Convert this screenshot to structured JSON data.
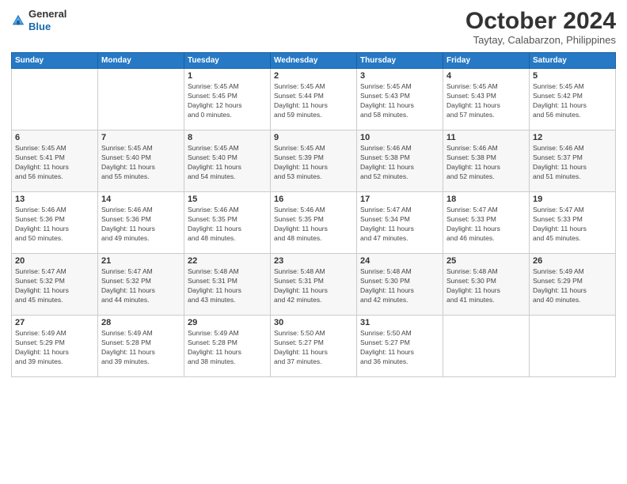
{
  "header": {
    "logo_general": "General",
    "logo_blue": "Blue",
    "month": "October 2024",
    "location": "Taytay, Calabarzon, Philippines"
  },
  "weekdays": [
    "Sunday",
    "Monday",
    "Tuesday",
    "Wednesday",
    "Thursday",
    "Friday",
    "Saturday"
  ],
  "weeks": [
    [
      {
        "day": "",
        "info": ""
      },
      {
        "day": "",
        "info": ""
      },
      {
        "day": "1",
        "info": "Sunrise: 5:45 AM\nSunset: 5:45 PM\nDaylight: 12 hours\nand 0 minutes."
      },
      {
        "day": "2",
        "info": "Sunrise: 5:45 AM\nSunset: 5:44 PM\nDaylight: 11 hours\nand 59 minutes."
      },
      {
        "day": "3",
        "info": "Sunrise: 5:45 AM\nSunset: 5:43 PM\nDaylight: 11 hours\nand 58 minutes."
      },
      {
        "day": "4",
        "info": "Sunrise: 5:45 AM\nSunset: 5:43 PM\nDaylight: 11 hours\nand 57 minutes."
      },
      {
        "day": "5",
        "info": "Sunrise: 5:45 AM\nSunset: 5:42 PM\nDaylight: 11 hours\nand 56 minutes."
      }
    ],
    [
      {
        "day": "6",
        "info": "Sunrise: 5:45 AM\nSunset: 5:41 PM\nDaylight: 11 hours\nand 56 minutes."
      },
      {
        "day": "7",
        "info": "Sunrise: 5:45 AM\nSunset: 5:40 PM\nDaylight: 11 hours\nand 55 minutes."
      },
      {
        "day": "8",
        "info": "Sunrise: 5:45 AM\nSunset: 5:40 PM\nDaylight: 11 hours\nand 54 minutes."
      },
      {
        "day": "9",
        "info": "Sunrise: 5:45 AM\nSunset: 5:39 PM\nDaylight: 11 hours\nand 53 minutes."
      },
      {
        "day": "10",
        "info": "Sunrise: 5:46 AM\nSunset: 5:38 PM\nDaylight: 11 hours\nand 52 minutes."
      },
      {
        "day": "11",
        "info": "Sunrise: 5:46 AM\nSunset: 5:38 PM\nDaylight: 11 hours\nand 52 minutes."
      },
      {
        "day": "12",
        "info": "Sunrise: 5:46 AM\nSunset: 5:37 PM\nDaylight: 11 hours\nand 51 minutes."
      }
    ],
    [
      {
        "day": "13",
        "info": "Sunrise: 5:46 AM\nSunset: 5:36 PM\nDaylight: 11 hours\nand 50 minutes."
      },
      {
        "day": "14",
        "info": "Sunrise: 5:46 AM\nSunset: 5:36 PM\nDaylight: 11 hours\nand 49 minutes."
      },
      {
        "day": "15",
        "info": "Sunrise: 5:46 AM\nSunset: 5:35 PM\nDaylight: 11 hours\nand 48 minutes."
      },
      {
        "day": "16",
        "info": "Sunrise: 5:46 AM\nSunset: 5:35 PM\nDaylight: 11 hours\nand 48 minutes."
      },
      {
        "day": "17",
        "info": "Sunrise: 5:47 AM\nSunset: 5:34 PM\nDaylight: 11 hours\nand 47 minutes."
      },
      {
        "day": "18",
        "info": "Sunrise: 5:47 AM\nSunset: 5:33 PM\nDaylight: 11 hours\nand 46 minutes."
      },
      {
        "day": "19",
        "info": "Sunrise: 5:47 AM\nSunset: 5:33 PM\nDaylight: 11 hours\nand 45 minutes."
      }
    ],
    [
      {
        "day": "20",
        "info": "Sunrise: 5:47 AM\nSunset: 5:32 PM\nDaylight: 11 hours\nand 45 minutes."
      },
      {
        "day": "21",
        "info": "Sunrise: 5:47 AM\nSunset: 5:32 PM\nDaylight: 11 hours\nand 44 minutes."
      },
      {
        "day": "22",
        "info": "Sunrise: 5:48 AM\nSunset: 5:31 PM\nDaylight: 11 hours\nand 43 minutes."
      },
      {
        "day": "23",
        "info": "Sunrise: 5:48 AM\nSunset: 5:31 PM\nDaylight: 11 hours\nand 42 minutes."
      },
      {
        "day": "24",
        "info": "Sunrise: 5:48 AM\nSunset: 5:30 PM\nDaylight: 11 hours\nand 42 minutes."
      },
      {
        "day": "25",
        "info": "Sunrise: 5:48 AM\nSunset: 5:30 PM\nDaylight: 11 hours\nand 41 minutes."
      },
      {
        "day": "26",
        "info": "Sunrise: 5:49 AM\nSunset: 5:29 PM\nDaylight: 11 hours\nand 40 minutes."
      }
    ],
    [
      {
        "day": "27",
        "info": "Sunrise: 5:49 AM\nSunset: 5:29 PM\nDaylight: 11 hours\nand 39 minutes."
      },
      {
        "day": "28",
        "info": "Sunrise: 5:49 AM\nSunset: 5:28 PM\nDaylight: 11 hours\nand 39 minutes."
      },
      {
        "day": "29",
        "info": "Sunrise: 5:49 AM\nSunset: 5:28 PM\nDaylight: 11 hours\nand 38 minutes."
      },
      {
        "day": "30",
        "info": "Sunrise: 5:50 AM\nSunset: 5:27 PM\nDaylight: 11 hours\nand 37 minutes."
      },
      {
        "day": "31",
        "info": "Sunrise: 5:50 AM\nSunset: 5:27 PM\nDaylight: 11 hours\nand 36 minutes."
      },
      {
        "day": "",
        "info": ""
      },
      {
        "day": "",
        "info": ""
      }
    ]
  ]
}
